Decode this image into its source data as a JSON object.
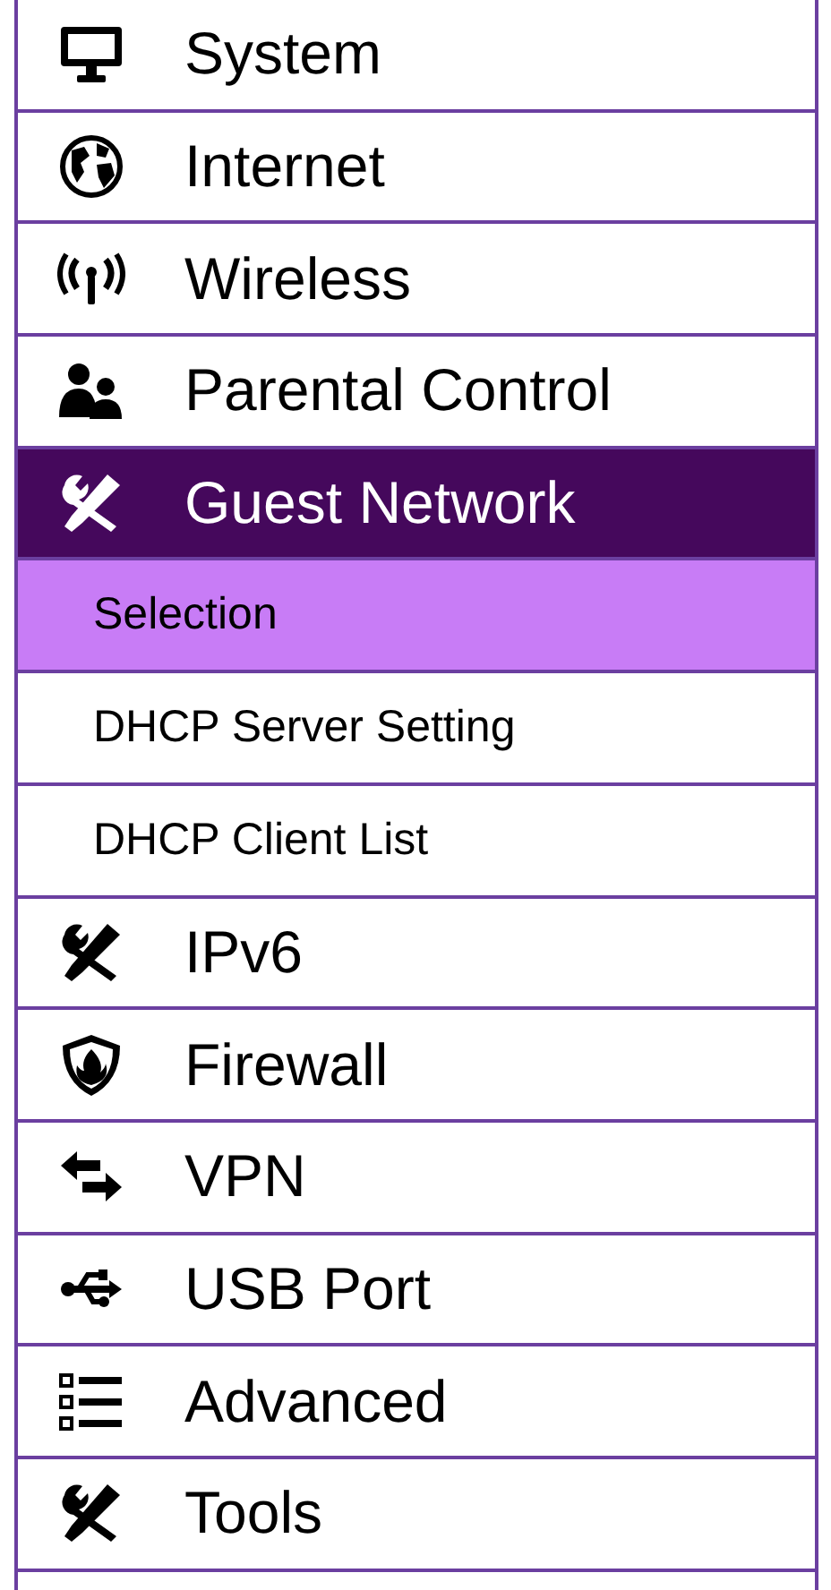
{
  "menu": [
    {
      "label": "System",
      "selected": false
    },
    {
      "label": "Internet",
      "selected": false
    },
    {
      "label": "Wireless",
      "selected": false
    },
    {
      "label": "Parental Control",
      "selected": false
    },
    {
      "label": "Guest Network",
      "selected": true,
      "children": [
        {
          "label": "Selection",
          "selected": true
        },
        {
          "label": "DHCP Server Setting",
          "selected": false
        },
        {
          "label": "DHCP Client List",
          "selected": false
        }
      ]
    },
    {
      "label": "IPv6",
      "selected": false
    },
    {
      "label": "Firewall",
      "selected": false
    },
    {
      "label": "VPN",
      "selected": false
    },
    {
      "label": "USB Port",
      "selected": false
    },
    {
      "label": "Advanced",
      "selected": false
    },
    {
      "label": "Tools",
      "selected": false
    }
  ]
}
